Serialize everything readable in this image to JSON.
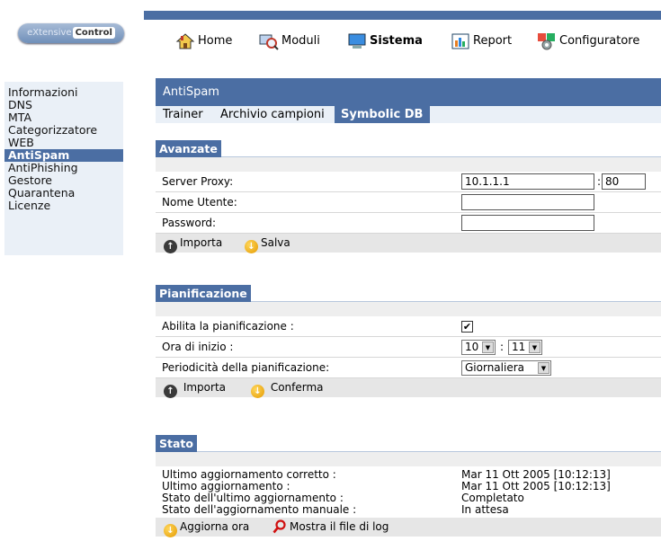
{
  "logo": {
    "prefix": "eXtensive",
    "suffix": "Control"
  },
  "nav": [
    {
      "label": "Home",
      "icon": "home-icon"
    },
    {
      "label": "Moduli",
      "icon": "modules-icon"
    },
    {
      "label": "Sistema",
      "icon": "system-icon"
    },
    {
      "label": "Report",
      "icon": "report-icon"
    },
    {
      "label": "Configuratore",
      "icon": "configurator-icon"
    }
  ],
  "sidebar": [
    {
      "label": "Informazioni"
    },
    {
      "label": "DNS"
    },
    {
      "label": "MTA"
    },
    {
      "label": "Categorizzatore"
    },
    {
      "label": "WEB"
    },
    {
      "label": "AntiSpam"
    },
    {
      "label": "AntiPhishing"
    },
    {
      "label": "Gestore"
    },
    {
      "label": "Quarantena"
    },
    {
      "label": "Licenze"
    }
  ],
  "main": {
    "title": "AntiSpam",
    "tabs": [
      {
        "label": "Trainer"
      },
      {
        "label": "Archivio campioni"
      },
      {
        "label": "Symbolic DB"
      }
    ]
  },
  "avanzate": {
    "title": "Avanzate",
    "server_proxy_label": "Server Proxy:",
    "server_proxy_value": "10.1.1.1",
    "port_sep": ":",
    "port_value": "80",
    "username_label": "Nome Utente:",
    "password_label": "Password:",
    "import_label": "Importa",
    "save_label": "Salva"
  },
  "pianificazione": {
    "title": "Pianificazione",
    "enable_label": "Abilita la pianificazione :",
    "enable_checked": "✔",
    "start_label": "Ora di inizio :",
    "hour": "10",
    "time_sep": ":",
    "minute": "11",
    "period_label": "Periodicità della pianificazione:",
    "period_value": "Giornaliera",
    "import_label": "Importa",
    "confirm_label": "Conferma"
  },
  "stato": {
    "title": "Stato",
    "rows": [
      {
        "label": "Ultimo aggiornamento corretto :",
        "value": "Mar 11 Ott 2005 [10:12:13]"
      },
      {
        "label": "Ultimo aggiornamento :",
        "value": "Mar 11 Ott 2005 [10:12:13]"
      },
      {
        "label": "Stato dell'ultimo aggiornamento :",
        "value": "Completato"
      },
      {
        "label": "Stato dell'aggiornamento manuale :",
        "value": "In attesa"
      }
    ],
    "update_now_label": "Aggiorna ora",
    "show_log_label": "Mostra il file di log"
  },
  "colors": {
    "accent": "#4b6ea3",
    "panel": "#eaf0f7",
    "footer": "#e6e6e6"
  }
}
